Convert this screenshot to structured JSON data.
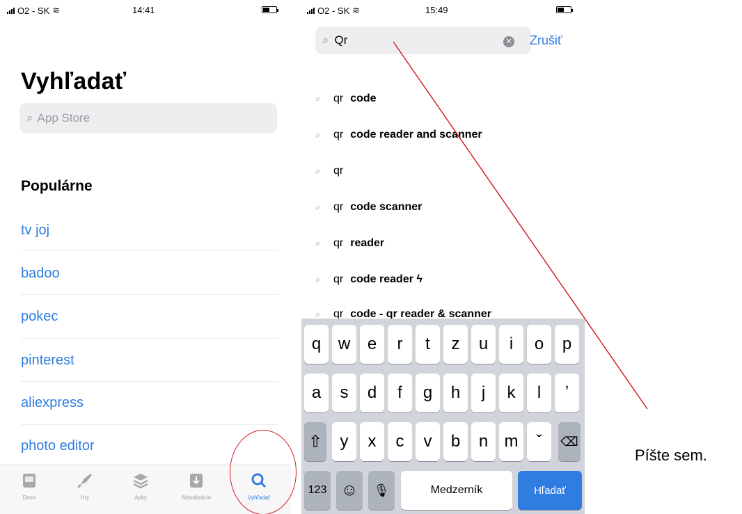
{
  "left_screen": {
    "status": {
      "carrier": "O2 - SK",
      "time": "14:41"
    },
    "title": "Vyhľadať",
    "search_placeholder": "App Store",
    "section_title": "Populárne",
    "trending": [
      "tv joj",
      "badoo",
      "pokec",
      "pinterest",
      "aliexpress",
      "photo editor"
    ],
    "tabs": [
      {
        "label": "Dnes",
        "icon": "today-icon"
      },
      {
        "label": "Hry",
        "icon": "rocket-icon"
      },
      {
        "label": "Apky",
        "icon": "layers-icon"
      },
      {
        "label": "Aktualizácie",
        "icon": "download-icon"
      },
      {
        "label": "Vyhľadať",
        "icon": "search-icon"
      }
    ]
  },
  "right_screen": {
    "status": {
      "carrier": "O2 - SK",
      "time": "15:49"
    },
    "search_value": "Qr",
    "cancel_label": "Zrušiť",
    "suggestions": [
      {
        "prefix": "qr",
        "rest": "code"
      },
      {
        "prefix": "qr",
        "rest": "code reader and scanner"
      },
      {
        "prefix": "qr",
        "rest": ""
      },
      {
        "prefix": "qr",
        "rest": "code scanner"
      },
      {
        "prefix": "qr",
        "rest": "reader"
      },
      {
        "prefix": "qr",
        "rest": "code reader ϟ"
      },
      {
        "prefix": "qr",
        "rest": "code - qr reader & scanner"
      }
    ],
    "keyboard": {
      "row1": [
        "q",
        "w",
        "e",
        "r",
        "t",
        "z",
        "u",
        "i",
        "o",
        "p"
      ],
      "row2": [
        "a",
        "s",
        "d",
        "f",
        "g",
        "h",
        "j",
        "k",
        "l",
        "ʼ"
      ],
      "row3": [
        "y",
        "x",
        "c",
        "v",
        "b",
        "n",
        "m",
        "ˇ"
      ],
      "numbers_key": "123",
      "space_label": "Medzerník",
      "search_key_label": "Hľadať"
    }
  },
  "annotation": {
    "text": "Píšte sem."
  },
  "colors": {
    "accent": "#2f7de1",
    "annotation_red": "#d0202a"
  }
}
